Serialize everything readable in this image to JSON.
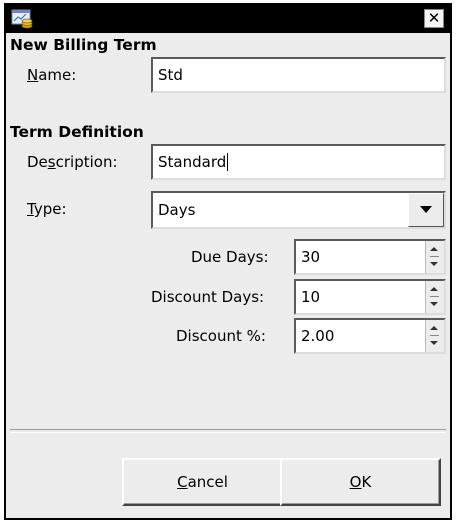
{
  "window": {
    "close_glyph": "✕",
    "app_icon": "billing-app-icon"
  },
  "billing_term": {
    "section_title": "New Billing Term",
    "name_label_pre": "",
    "name_label_mn": "N",
    "name_label_post": "ame:",
    "name_value": "Std"
  },
  "term_definition": {
    "section_title": "Term Definition",
    "description_label_pre": "De",
    "description_label_mn": "s",
    "description_label_post": "cription:",
    "description_value": "Standard",
    "type_label_pre": "",
    "type_label_mn": "T",
    "type_label_post": "ype:",
    "type_value": "Days",
    "due_days_label": "Due Days:",
    "due_days_value": "30",
    "discount_days_label": "Discount Days:",
    "discount_days_value": "10",
    "discount_pct_label": "Discount %:",
    "discount_pct_value": "2.00"
  },
  "buttons": {
    "cancel_pre": "",
    "cancel_mn": "C",
    "cancel_post": "ancel",
    "ok_pre": "",
    "ok_mn": "O",
    "ok_post": "K"
  }
}
